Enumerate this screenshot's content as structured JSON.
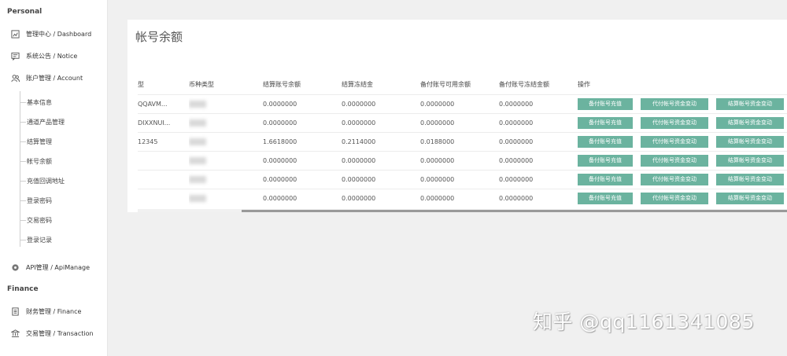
{
  "sidebar": {
    "section_personal": "Personal",
    "section_finance": "Finance",
    "items": {
      "dashboard": "管理中心 / Dashboard",
      "notice": "系统公告 / Notice",
      "account": "账户管理 / Account",
      "apimanage": "API管理 / ApiManage",
      "finance": "财务管理 / Finance",
      "transaction": "交易管理 / Transaction"
    },
    "sub_items": [
      "基本信息",
      "通道产品管理",
      "结算管理",
      "帐号余额",
      "充值回调地址",
      "登录密码",
      "交易密码",
      "登录记录"
    ]
  },
  "panel": {
    "title": "帐号余额"
  },
  "table": {
    "headers": [
      "型",
      "币种类型",
      "结算账号余额",
      "结算冻结金",
      "备付账号可用余额",
      "备付账号冻结金额",
      "操作"
    ],
    "rows": [
      {
        "type": "QQAVM...",
        "settle_balance": "0.0000000",
        "settle_frozen": "0.0000000",
        "reserve_available": "0.0000000",
        "reserve_frozen": "0.0000000"
      },
      {
        "type": "DIXXNUI...",
        "settle_balance": "0.0000000",
        "settle_frozen": "0.0000000",
        "reserve_available": "0.0000000",
        "reserve_frozen": "0.0000000"
      },
      {
        "type": "12345",
        "settle_balance": "1.6618000",
        "settle_frozen": "0.2114000",
        "reserve_available": "0.0188000",
        "reserve_frozen": "0.0000000"
      },
      {
        "type": "",
        "settle_balance": "0.0000000",
        "settle_frozen": "0.0000000",
        "reserve_available": "0.0000000",
        "reserve_frozen": "0.0000000"
      },
      {
        "type": "",
        "settle_balance": "0.0000000",
        "settle_frozen": "0.0000000",
        "reserve_available": "0.0000000",
        "reserve_frozen": "0.0000000"
      },
      {
        "type": "",
        "settle_balance": "0.0000000",
        "settle_frozen": "0.0000000",
        "reserve_available": "0.0000000",
        "reserve_frozen": "0.0000000"
      }
    ],
    "actions": {
      "recharge": "备付账号充值",
      "payout_change": "代付帐号资金变动",
      "settle_change": "结算帐号资金变动"
    }
  },
  "watermark": "知乎 @qq1161341085",
  "colors": {
    "action_button": "#6bb39f",
    "scroll_thumb": "#9a9a9a",
    "background": "#f0f0f0"
  },
  "icons": {
    "dashboard": "chart-icon",
    "notice": "message-icon",
    "account": "users-icon",
    "apimanage": "api-icon",
    "finance": "document-icon",
    "transaction": "bank-icon"
  }
}
